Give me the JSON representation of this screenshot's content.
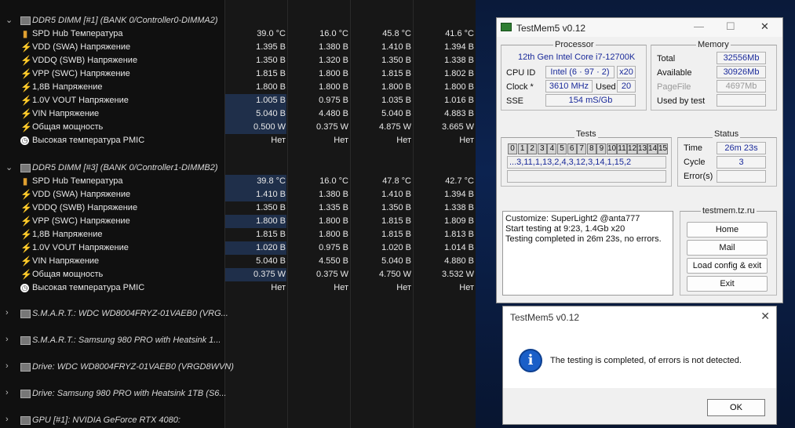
{
  "hwinfo": {
    "groups": [
      {
        "title": "DDR5 DIMM [#1] (BANK 0/Controller0-DIMMA2)",
        "rows": [
          {
            "icon": "therm",
            "label": "SPD Hub Температура",
            "v": [
              "39.0 °C",
              "16.0 °C",
              "45.8 °C",
              "41.6 °C"
            ],
            "hl": false
          },
          {
            "icon": "bolt",
            "label": "VDD (SWA) Напряжение",
            "v": [
              "1.395 В",
              "1.380 В",
              "1.410 В",
              "1.394 В"
            ],
            "hl": false
          },
          {
            "icon": "bolt",
            "label": "VDDQ (SWB) Напряжение",
            "v": [
              "1.350 В",
              "1.320 В",
              "1.350 В",
              "1.338 В"
            ],
            "hl": false
          },
          {
            "icon": "bolt",
            "label": "VPP (SWC) Напряжение",
            "v": [
              "1.815 В",
              "1.800 В",
              "1.815 В",
              "1.802 В"
            ],
            "hl": false
          },
          {
            "icon": "bolt",
            "label": "1,8В Напряжение",
            "v": [
              "1.800 В",
              "1.800 В",
              "1.800 В",
              "1.800 В"
            ],
            "hl": false
          },
          {
            "icon": "bolt",
            "label": "1.0V VOUT Напряжение",
            "v": [
              "1.005 В",
              "0.975 В",
              "1.035 В",
              "1.016 В"
            ],
            "hl": true
          },
          {
            "icon": "bolt",
            "label": "VIN Напряжение",
            "v": [
              "5.040 В",
              "4.480 В",
              "5.040 В",
              "4.883 В"
            ],
            "hl": true
          },
          {
            "icon": "bolt",
            "label": "Общая мощность",
            "v": [
              "0.500 W",
              "0.375 W",
              "4.875 W",
              "3.665 W"
            ],
            "hl": true
          },
          {
            "icon": "clock",
            "label": "Высокая температура PMIC",
            "v": [
              "Нет",
              "Нет",
              "Нет",
              "Нет"
            ],
            "hl": false
          }
        ]
      },
      {
        "title": "DDR5 DIMM [#3] (BANK 0/Controller1-DIMMB2)",
        "rows": [
          {
            "icon": "therm",
            "label": "SPD Hub Температура",
            "v": [
              "39.8 °C",
              "16.0 °C",
              "47.8 °C",
              "42.7 °C"
            ],
            "hl": true
          },
          {
            "icon": "bolt",
            "label": "VDD (SWA) Напряжение",
            "v": [
              "1.410 В",
              "1.380 В",
              "1.410 В",
              "1.394 В"
            ],
            "hl": true
          },
          {
            "icon": "bolt",
            "label": "VDDQ (SWB) Напряжение",
            "v": [
              "1.350 В",
              "1.335 В",
              "1.350 В",
              "1.338 В"
            ],
            "hl": false
          },
          {
            "icon": "bolt",
            "label": "VPP (SWC) Напряжение",
            "v": [
              "1.800 В",
              "1.800 В",
              "1.815 В",
              "1.809 В"
            ],
            "hl": true
          },
          {
            "icon": "bolt",
            "label": "1,8В Напряжение",
            "v": [
              "1.815 В",
              "1.800 В",
              "1.815 В",
              "1.813 В"
            ],
            "hl": false
          },
          {
            "icon": "bolt",
            "label": "1.0V VOUT Напряжение",
            "v": [
              "1.020 В",
              "0.975 В",
              "1.020 В",
              "1.014 В"
            ],
            "hl": true
          },
          {
            "icon": "bolt",
            "label": "VIN Напряжение",
            "v": [
              "5.040 В",
              "4.550 В",
              "5.040 В",
              "4.880 В"
            ],
            "hl": false
          },
          {
            "icon": "bolt",
            "label": "Общая мощность",
            "v": [
              "0.375 W",
              "0.375 W",
              "4.750 W",
              "3.532 W"
            ],
            "hl": true
          },
          {
            "icon": "clock",
            "label": "Высокая температура PMIC",
            "v": [
              "Нет",
              "Нет",
              "Нет",
              "Нет"
            ],
            "hl": false
          }
        ]
      }
    ],
    "collapsed": [
      "S.M.A.R.T.: WDC WD8004FRYZ-01VAEB0 (VRG...",
      "S.M.A.R.T.: Samsung 980 PRO with Heatsink 1...",
      "Drive: WDC WD8004FRYZ-01VAEB0 (VRGD8WVN)",
      "Drive: Samsung 980 PRO with Heatsink 1TB (S6...",
      "GPU [#1]: NVIDIA GeForce RTX 4080:"
    ]
  },
  "testmem": {
    "title": "TestMem5 v0.12",
    "processor": {
      "heading": "Processor",
      "name": "12th Gen Intel Core i7-12700K",
      "cpuid_label": "CPU ID",
      "cpuid": "Intel  (6 · 97 · 2)",
      "threads": "x20",
      "clock_label": "Clock *",
      "clock": "3610 MHz",
      "used_label": "Used",
      "used": "20",
      "sse_label": "SSE",
      "sse": "154 mS/Gb"
    },
    "memory": {
      "heading": "Memory",
      "total_label": "Total",
      "total": "32556Mb",
      "available_label": "Available",
      "available": "30926Mb",
      "pagefile_label": "PageFile",
      "pagefile": "4697Mb",
      "usedbytest_label": "Used by test",
      "usedbytest": ""
    },
    "tests": {
      "heading": "Tests",
      "cells": [
        "0",
        "1",
        "2",
        "3",
        "4",
        "5",
        "6",
        "7",
        "8",
        "9",
        "10",
        "11",
        "12",
        "13",
        "14",
        "15"
      ],
      "sequence": "...3,11,1,13,2,4,3,12,3,14,1,15,2"
    },
    "status": {
      "heading": "Status",
      "time_label": "Time",
      "time": "26m 23s",
      "cycle_label": "Cycle",
      "cycle": "3",
      "errors_label": "Error(s)",
      "errors": ""
    },
    "log": [
      "Customize: SuperLight2 @anta777",
      "Start testing at 9:23, 1.4Gb x20",
      "Testing completed in 26m 23s, no errors."
    ],
    "site": "testmem.tz.ru",
    "buttons": {
      "home": "Home",
      "mail": "Mail",
      "load": "Load config & exit",
      "exit": "Exit"
    }
  },
  "dialog": {
    "title": "TestMem5 v0.12",
    "message": "The testing is completed, of errors is not detected.",
    "ok": "OK"
  }
}
